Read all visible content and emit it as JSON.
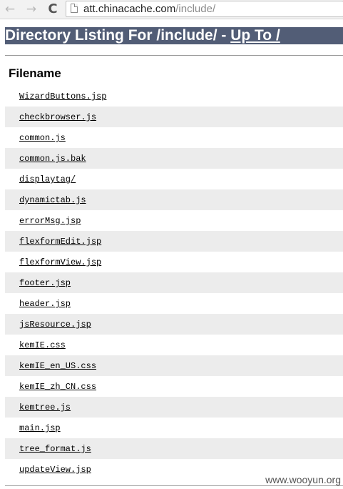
{
  "browser": {
    "back_glyph": "←",
    "forward_glyph": "→",
    "reload_glyph": "C",
    "url_host": "att.chinacache.com",
    "url_path": "/include/"
  },
  "page": {
    "heading_text": "Directory Listing For /include/ - ",
    "heading_link": "Up To /",
    "column_header": "Filename",
    "files": [
      "WizardButtons.jsp",
      "checkbrowser.js",
      "common.js",
      "common.js.bak",
      "displaytag/",
      "dynamictab.js",
      "errorMsg.jsp",
      "flexformEdit.jsp",
      "flexformView.jsp",
      "footer.jsp",
      "header.jsp",
      "jsResource.jsp",
      "kemIE.css",
      "kemIE_en_US.css",
      "kemIE_zh_CN.css",
      "kemtree.js",
      "main.jsp",
      "tree_format.js",
      "updateView.jsp"
    ]
  },
  "watermark": "www.wooyun.org",
  "colors": {
    "heading_bg": "#525d76",
    "row_alt": "#ececec"
  }
}
